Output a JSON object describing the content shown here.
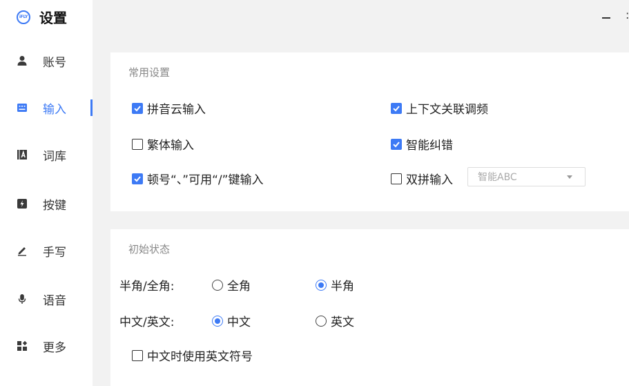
{
  "app": {
    "title": "设置",
    "logo_text": "iFLY"
  },
  "sidebar": {
    "items": [
      {
        "label": "账号",
        "icon": "user-icon",
        "active": false
      },
      {
        "label": "输入",
        "icon": "keyboard-icon",
        "active": true
      },
      {
        "label": "词库",
        "icon": "dictionary-icon",
        "active": false
      },
      {
        "label": "按键",
        "icon": "key-icon",
        "active": false
      },
      {
        "label": "手写",
        "icon": "pen-icon",
        "active": false
      },
      {
        "label": "语音",
        "icon": "microphone-icon",
        "active": false
      },
      {
        "label": "更多",
        "icon": "more-grid-icon",
        "active": false
      }
    ]
  },
  "window": {
    "minimize_icon": "minimize-icon",
    "close_partial": ":"
  },
  "common_settings": {
    "title": "常用设置",
    "options": {
      "pinyin_cloud": {
        "label": "拼音云输入",
        "checked": true
      },
      "context_freq": {
        "label": "上下文关联调频",
        "checked": true
      },
      "traditional": {
        "label": "繁体输入",
        "checked": false
      },
      "smart_correct": {
        "label": "智能纠错",
        "checked": true
      },
      "slash_pause": {
        "label": "顿号“、”可用“/”键输入",
        "checked": true
      },
      "double_pinyin": {
        "label": "双拼输入",
        "checked": false
      }
    },
    "double_pinyin_scheme": {
      "value": "智能ABC"
    }
  },
  "initial_state": {
    "title": "初始状态",
    "width_label": "半角/全角:",
    "width_full": {
      "label": "全角",
      "selected": false
    },
    "width_half": {
      "label": "半角",
      "selected": true
    },
    "lang_label": "中文/英文:",
    "lang_cn": {
      "label": "中文",
      "selected": true
    },
    "lang_en": {
      "label": "英文",
      "selected": false
    },
    "en_symbols": {
      "label": "中文时使用英文符号",
      "checked": false
    }
  },
  "colors": {
    "accent": "#3d7af5",
    "background": "#f2f2f2",
    "card": "#ffffff"
  }
}
